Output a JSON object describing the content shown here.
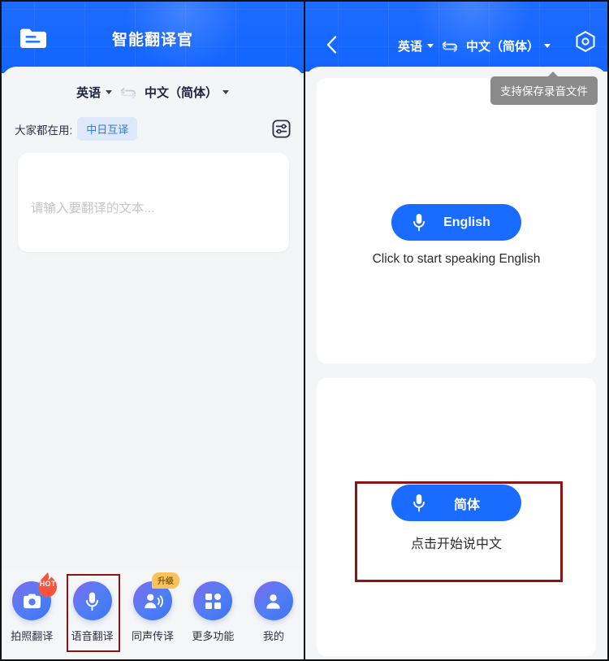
{
  "left_panel": {
    "header": {
      "folder_icon": "folder-document-icon",
      "app_title": "智能翻译官"
    },
    "language_bar": {
      "source_language": "英语",
      "swap_icon": "swap-languages-icon",
      "target_language": "中文（简体）"
    },
    "popular": {
      "label": "大家都在用:",
      "chip": "中日互译",
      "settings_icon": "sliders-settings-icon"
    },
    "input": {
      "placeholder": "请输入要翻译的文本...",
      "value": ""
    },
    "tabbar": [
      {
        "label": "拍照翻译",
        "icon": "camera-icon",
        "badge": "HOT",
        "badge_type": "hot",
        "highlighted": false
      },
      {
        "label": "语音翻译",
        "icon": "microphone-icon",
        "badge": "",
        "badge_type": "",
        "highlighted": true
      },
      {
        "label": "同声传译",
        "icon": "person-speaking-icon",
        "badge": "升级",
        "badge_type": "upgrade",
        "highlighted": false
      },
      {
        "label": "更多功能",
        "icon": "grid-apps-icon",
        "badge": "",
        "badge_type": "",
        "highlighted": false
      },
      {
        "label": "我的",
        "icon": "person-account-icon",
        "badge": "",
        "badge_type": "",
        "highlighted": false
      }
    ]
  },
  "right_panel": {
    "header": {
      "back_icon": "back-chevron-icon",
      "source_language": "英语",
      "swap_icon": "swap-languages-icon",
      "target_language": "中文（简体）",
      "settings_icon": "hex-settings-icon"
    },
    "tooltip": "支持保存录音文件",
    "cards": [
      {
        "button_label": "English",
        "button_icon": "microphone-icon",
        "hint": "Click to start speaking English",
        "highlighted": false
      },
      {
        "button_label": "简体",
        "button_icon": "microphone-icon",
        "hint": "点击开始说中文",
        "highlighted": true
      }
    ]
  },
  "colors": {
    "brand_blue": "#1a6bff",
    "header_blue": "#1668ff",
    "page_bg": "#f4f5f7",
    "chip_bg": "#dde8fb",
    "chip_text": "#2f7ae5",
    "annotation_red": "#8c1414",
    "badge_hot": "#f7543f",
    "badge_upgrade": "#f7c45c",
    "tooltip_bg": "#8a8a8a"
  }
}
